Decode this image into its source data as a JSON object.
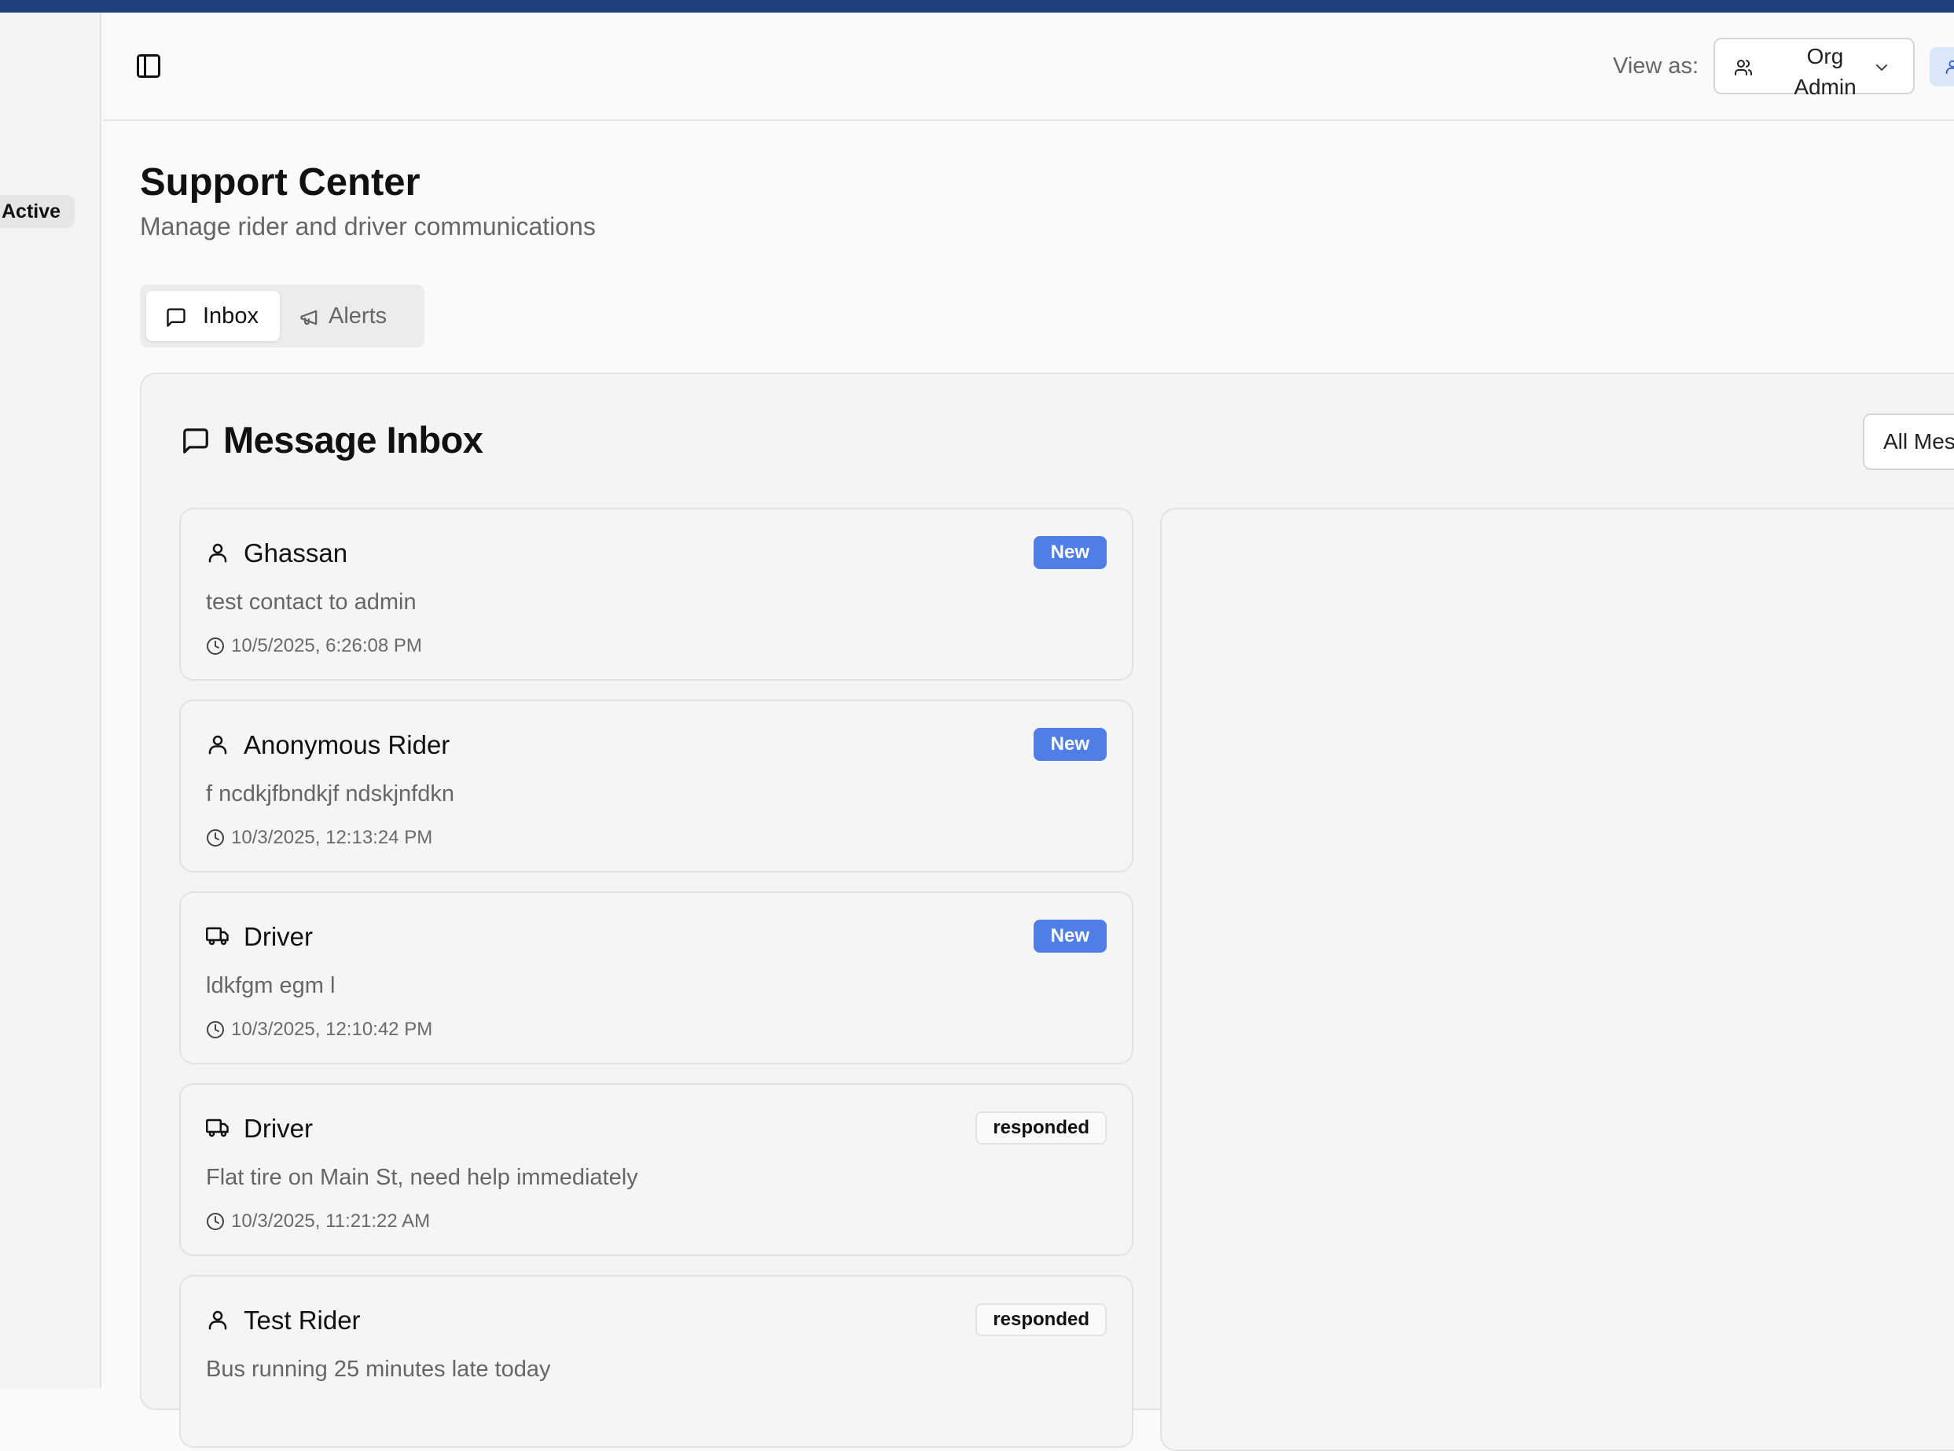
{
  "sidebar": {
    "status_badge": "Active"
  },
  "header": {
    "view_as_label": "View as:",
    "view_as_value": "Org\nAdmin"
  },
  "page": {
    "title": "Support Center",
    "subtitle": "Manage rider and driver communications"
  },
  "tabs": [
    {
      "label": "Inbox",
      "icon": "message-square-icon",
      "active": true
    },
    {
      "label": "Alerts",
      "icon": "megaphone-icon",
      "active": false
    }
  ],
  "inbox": {
    "title": "Message Inbox",
    "filter_value": "All Mes",
    "messages": [
      {
        "sender": "Ghassan",
        "sender_icon": "user-icon",
        "body": "test contact to admin",
        "time": "10/5/2025, 6:26:08 PM",
        "status": "New"
      },
      {
        "sender": "Anonymous Rider",
        "sender_icon": "user-icon",
        "body": "f ncdkjfbndkjf ndskjnfdkn",
        "time": "10/3/2025, 12:13:24 PM",
        "status": "New"
      },
      {
        "sender": "Driver",
        "sender_icon": "truck-icon",
        "body": "ldkfgm egm l",
        "time": "10/3/2025, 12:10:42 PM",
        "status": "New"
      },
      {
        "sender": "Driver",
        "sender_icon": "truck-icon",
        "body": "Flat tire on Main St, need help immediately",
        "time": "10/3/2025, 11:21:22 AM",
        "status": "responded"
      },
      {
        "sender": "Test Rider",
        "sender_icon": "user-icon",
        "body": "Bus running 25 minutes late today",
        "time": "",
        "status": "responded"
      }
    ]
  },
  "colors": {
    "topbar": "#1f3f7a",
    "badge_new": "#4f7fe6",
    "user_chip": "#dbe6fb"
  }
}
